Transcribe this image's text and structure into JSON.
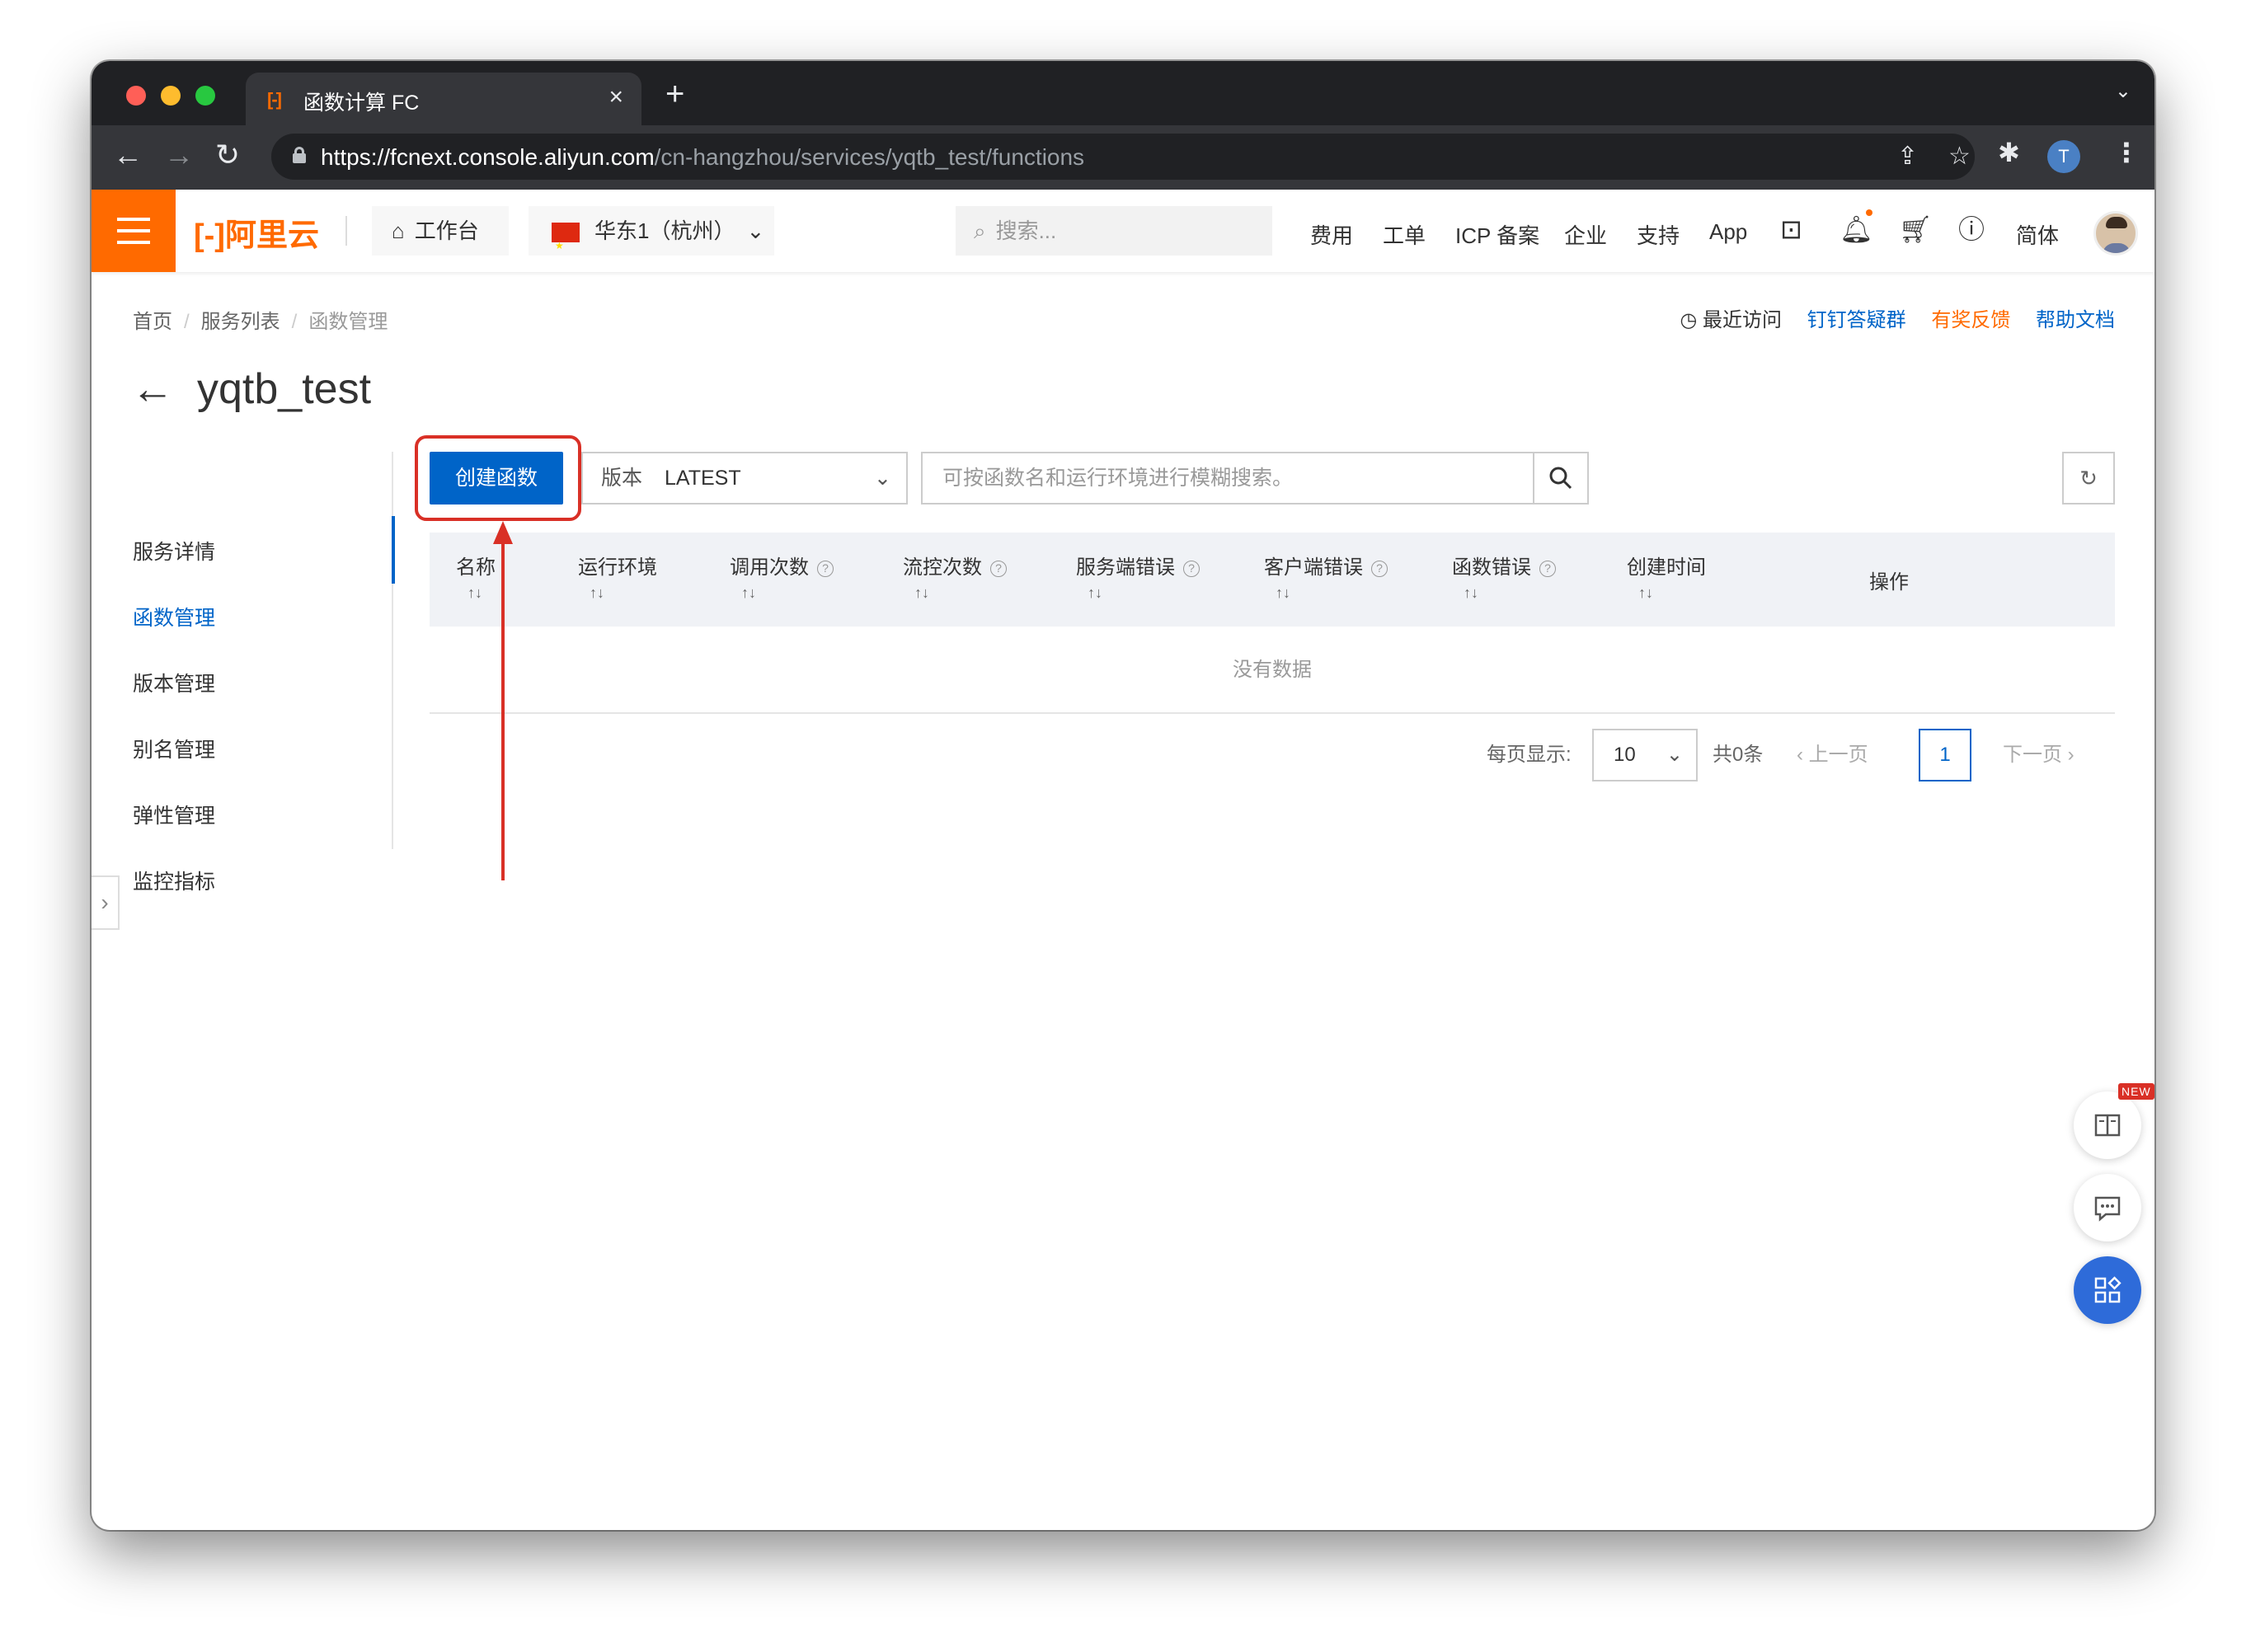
{
  "browser": {
    "tab_title": "函数计算 FC",
    "tab_icon": "[-]",
    "close_glyph": "×",
    "new_tab_glyph": "+",
    "url_host": "https://fcnext.console.aliyun.com",
    "url_path": "/cn-hangzhou/services/yqtb_test/functions",
    "profile_initial": "T"
  },
  "header": {
    "logo": "[-]阿里云",
    "workbench_label": "工作台",
    "region_label": "华东1（杭州）",
    "search_placeholder": "搜索...",
    "links": [
      "费用",
      "工单",
      "ICP 备案",
      "企业",
      "支持",
      "App"
    ],
    "lang": "简体"
  },
  "breadcrumb": [
    "首页",
    "服务列表",
    "函数管理"
  ],
  "top_links": {
    "recent": "最近访问",
    "dingtalk": "钉钉答疑群",
    "feedback": "有奖反馈",
    "docs": "帮助文档"
  },
  "page": {
    "title": "yqtb_test"
  },
  "sidenav": {
    "items": [
      "服务详情",
      "函数管理",
      "版本管理",
      "别名管理",
      "弹性管理",
      "监控指标"
    ],
    "active_index": 1
  },
  "toolbar": {
    "create_label": "创建函数",
    "version_prefix": "版本",
    "version_value": "LATEST",
    "search_placeholder": "可按函数名和运行环境进行模糊搜索。"
  },
  "table": {
    "columns": [
      "名称",
      "运行环境",
      "调用次数",
      "流控次数",
      "服务端错误",
      "客户端错误",
      "函数错误",
      "创建时间",
      "操作"
    ],
    "sort_glyph": "↑↓",
    "help_glyph": "?",
    "empty_text": "没有数据"
  },
  "pagination": {
    "per_page_label": "每页显示:",
    "per_page_value": "10",
    "total": "共0条",
    "prev": "上一页",
    "current": "1",
    "next": "下一页"
  },
  "floating": {
    "new_badge": "NEW"
  },
  "colors": {
    "brand_orange": "#ff6a00",
    "primary_blue": "#0064c8",
    "annotation_red": "#d93026"
  }
}
